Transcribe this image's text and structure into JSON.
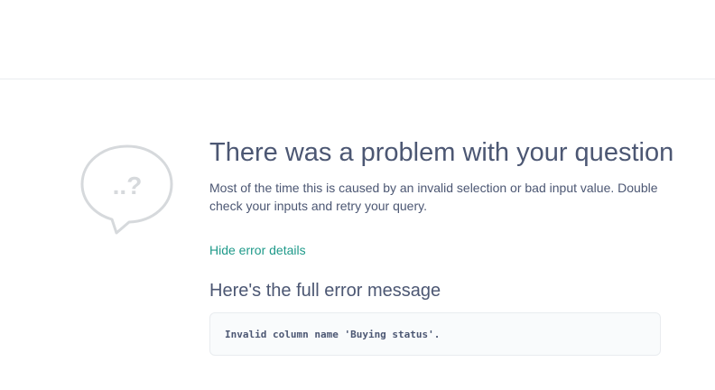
{
  "error_page": {
    "icon": "question-bubble-icon",
    "icon_text": "..?",
    "title": "There was a problem with your question",
    "description": "Most of the time this is caused by an invalid selection or bad input value. Double check your inputs and retry your query.",
    "toggle_label": "Hide error details",
    "details_heading": "Here's the full error message",
    "error_message": "Invalid column name 'Buying status'."
  },
  "colors": {
    "text": "#4c5773",
    "link": "#1f9a8a",
    "icon": "#d6d9dc",
    "code_bg": "#f9fbfc",
    "border": "#e9ecef"
  }
}
